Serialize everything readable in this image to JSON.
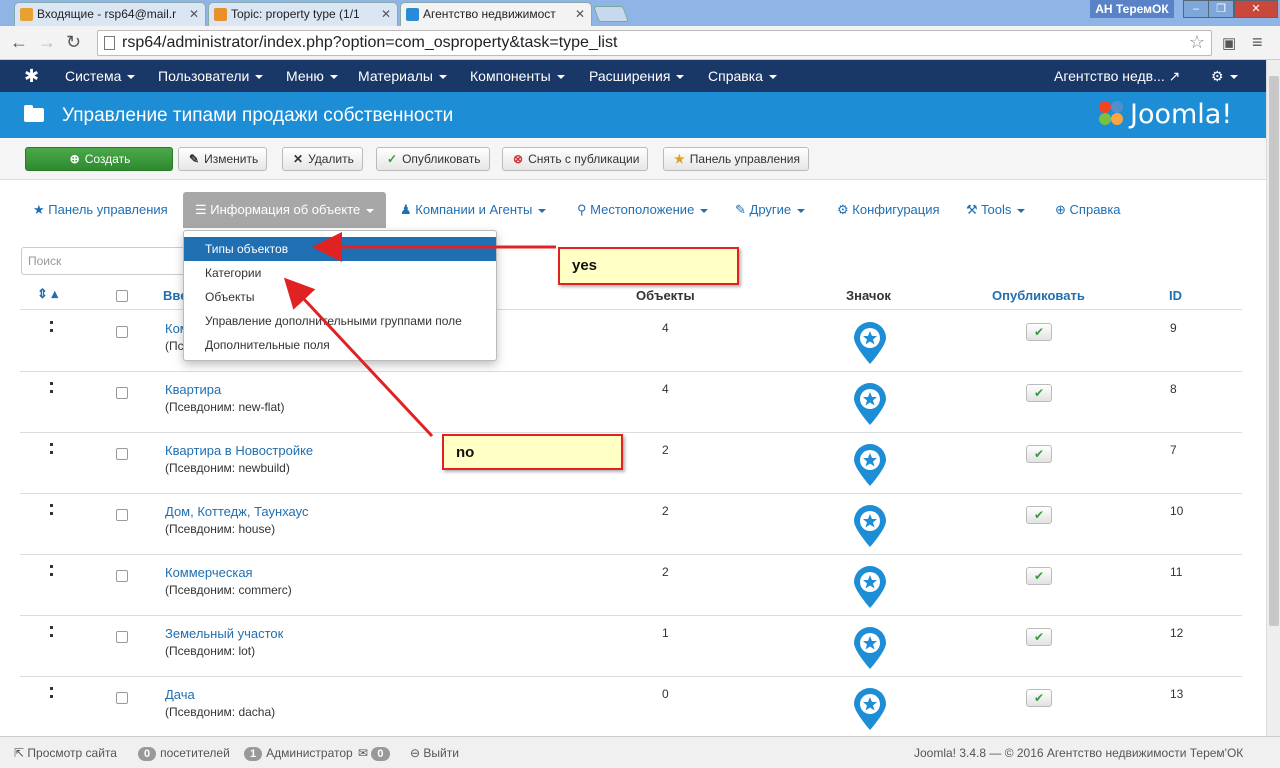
{
  "browser": {
    "tabs": [
      {
        "label": "Входящие - rsp64@mail.r",
        "favicon_color": "#e8a030"
      },
      {
        "label": "Topic: property type (1/1",
        "favicon_color": "#e8902a"
      },
      {
        "label": "Агентство недвижимост",
        "favicon_color": "#2a8ad8"
      }
    ],
    "profile": "АН ТеремОК",
    "url": "rsp64/administrator/index.php?option=com_osproperty&task=type_list"
  },
  "topnav": {
    "items": [
      "Система",
      "Пользователи",
      "Меню",
      "Материалы",
      "Компоненты",
      "Расширения",
      "Справка"
    ],
    "site_name": "Агентство недв..."
  },
  "header": {
    "title": "Управление типами продажи собственности",
    "logo_text": "Joomla!"
  },
  "toolbar": {
    "create": "Создать",
    "edit": "Изменить",
    "delete": "Удалить",
    "publish": "Опубликовать",
    "unpublish": "Снять с публикации",
    "panel": "Панель управления"
  },
  "subnav": {
    "items": [
      {
        "label": "Панель управления",
        "icon": "star-icon"
      },
      {
        "label": "Информация об объекте",
        "icon": "list-icon"
      },
      {
        "label": "Компании и Агенты",
        "icon": "user-icon"
      },
      {
        "label": "Местоположение",
        "icon": "map-marker-icon"
      },
      {
        "label": "Другие",
        "icon": "wrench-icon"
      },
      {
        "label": "Конфигурация",
        "icon": "gear-icon"
      },
      {
        "label": "Tools",
        "icon": "tools-icon"
      },
      {
        "label": "Справка",
        "icon": "lifebuoy-icon"
      }
    ]
  },
  "dropdown": {
    "items": [
      "Типы объектов",
      "Категории",
      "Объекты",
      "Управление дополнительными группами поле",
      "Дополнительные поля"
    ]
  },
  "search": {
    "placeholder": "Поиск"
  },
  "table": {
    "headers": {
      "name": "Вве",
      "objects": "Объекты",
      "icon": "Значок",
      "published": "Опубликовать",
      "id": "ID"
    },
    "rows": [
      {
        "name": "Ком",
        "alias": "(Пс",
        "count": "4",
        "id": "9"
      },
      {
        "name": "Квартира",
        "alias": "(Псевдоним: new-flat)",
        "count": "4",
        "id": "8"
      },
      {
        "name": "Квартира в Новостройке",
        "alias": "(Псевдоним: newbuild)",
        "count": "2",
        "id": "7"
      },
      {
        "name": "Дом, Коттедж, Таунхаус",
        "alias": "(Псевдоним: house)",
        "count": "2",
        "id": "10"
      },
      {
        "name": "Коммерческая",
        "alias": "(Псевдоним: commerc)",
        "count": "2",
        "id": "11"
      },
      {
        "name": "Земельный участок",
        "alias": "(Псевдоним: lot)",
        "count": "1",
        "id": "12"
      },
      {
        "name": "Дача",
        "alias": "(Псевдоним: dacha)",
        "count": "0",
        "id": "13"
      }
    ]
  },
  "annotations": {
    "yes": "yes",
    "no": "no"
  },
  "status": {
    "view_site": "Просмотр сайта",
    "visitors_count": "0",
    "visitors": "посетителей",
    "admins_count": "1",
    "admins": "Администратор",
    "messages_count": "0",
    "logout": "Выйти",
    "footer": "Joomla! 3.4.8 — © 2016 Агентство недвижимости Терем'ОК"
  },
  "colors": {
    "nav": "#1a3867",
    "header": "#1d8ed6",
    "link": "#1f6fb2",
    "create": "#3a9a3a",
    "annotation_border": "#e02222"
  }
}
